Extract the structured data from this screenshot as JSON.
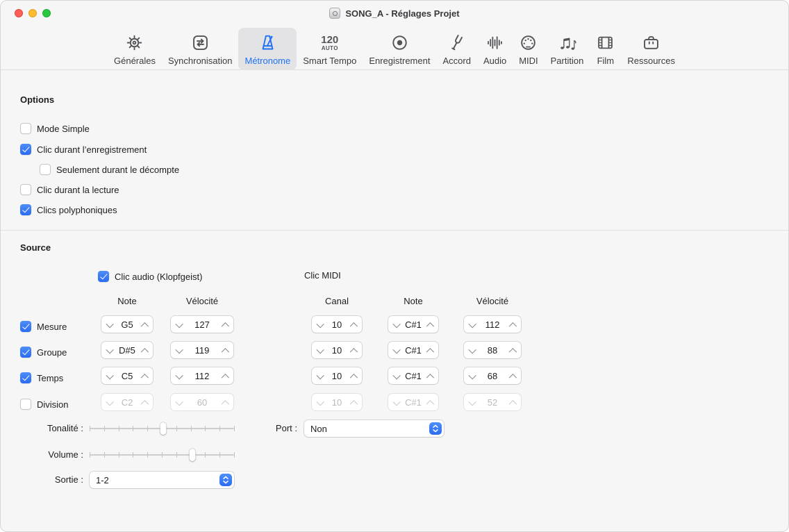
{
  "window": {
    "title": "SONG_A - Réglages Projet"
  },
  "colors": {
    "accent_blue": "#3478f6",
    "selected_tab_blue": "#1f72f5"
  },
  "toolbar": {
    "tabs": [
      {
        "label": "Générales",
        "selected": false
      },
      {
        "label": "Synchronisation",
        "selected": false
      },
      {
        "label": "Métronome",
        "selected": true
      },
      {
        "label": "Smart Tempo",
        "selected": false,
        "icon_line1": "120",
        "icon_line2": "AUTO"
      },
      {
        "label": "Enregistrement",
        "selected": false
      },
      {
        "label": "Accord",
        "selected": false
      },
      {
        "label": "Audio",
        "selected": false
      },
      {
        "label": "MIDI",
        "selected": false
      },
      {
        "label": "Partition",
        "selected": false
      },
      {
        "label": "Film",
        "selected": false
      },
      {
        "label": "Ressources",
        "selected": false
      }
    ]
  },
  "options": {
    "heading": "Options",
    "checkboxes": [
      {
        "label": "Mode Simple",
        "checked": false,
        "indent": false
      },
      {
        "label": "Clic durant l’enregistrement",
        "checked": true,
        "indent": false
      },
      {
        "label": "Seulement durant le décompte",
        "checked": false,
        "indent": true
      },
      {
        "label": "Clic durant la lecture",
        "checked": false,
        "indent": false
      },
      {
        "label": "Clics polyphoniques",
        "checked": true,
        "indent": false
      }
    ]
  },
  "source": {
    "heading": "Source",
    "audio_click": {
      "label": "Clic audio (Klopfgeist)",
      "checked": true
    },
    "midi_click_label": "Clic MIDI",
    "audio_columns": [
      "Note",
      "Vélocité"
    ],
    "midi_columns": [
      "Canal",
      "Note",
      "Vélocité"
    ],
    "rows": [
      {
        "label": "Mesure",
        "checked": true,
        "disabled": false,
        "note": "G5",
        "velocite": "127",
        "canal": "10",
        "midi_note": "C#1",
        "midi_velocite": "112"
      },
      {
        "label": "Groupe",
        "checked": true,
        "disabled": false,
        "note": "D#5",
        "velocite": "119",
        "canal": "10",
        "midi_note": "C#1",
        "midi_velocite": "88"
      },
      {
        "label": "Temps",
        "checked": true,
        "disabled": false,
        "note": "C5",
        "velocite": "112",
        "canal": "10",
        "midi_note": "C#1",
        "midi_velocite": "68"
      },
      {
        "label": "Division",
        "checked": false,
        "disabled": true,
        "note": "C2",
        "velocite": "60",
        "canal": "10",
        "midi_note": "C#1",
        "midi_velocite": "52"
      }
    ],
    "tonalite": {
      "label": "Tonalité :",
      "percent": 51
    },
    "volume": {
      "label": "Volume :",
      "percent": 71
    },
    "sortie": {
      "label": "Sortie :",
      "value": "1-2"
    },
    "port": {
      "label": "Port :",
      "value": "Non"
    }
  }
}
